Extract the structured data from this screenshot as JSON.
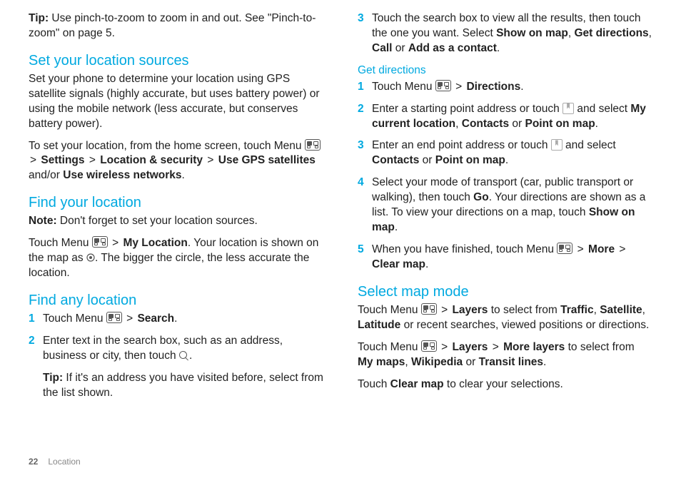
{
  "col1": {
    "tip_label": "Tip:",
    "tip_text": " Use pinch-to-zoom to zoom in and out. See \"Pinch-to-zoom\" on page 5.",
    "h_sources": "Set your location sources",
    "p_sources": "Set your phone to determine your location using GPS satellite signals (highly accurate, but uses battery power) or using the mobile network (less accurate, but conserves battery power).",
    "p_set1": "To set your location, from the home screen, touch Menu ",
    "gt": ">",
    "b_settings": "Settings",
    "b_locsec": "Location & security",
    "b_usegps": "Use GPS satellites",
    "p_set_andor": " and/or ",
    "b_usewifi": "Use wireless networks",
    "period": ".",
    "h_findyour": "Find your location",
    "note_label": "Note:",
    "note_text": " Don't forget to set your location sources.",
    "p_touchmenu": "Touch Menu ",
    "b_myloc": "My Location",
    "p_myloc2": ". Your location is shown on the map as ",
    "p_myloc3": ". The bigger the circle, the less accurate the location.",
    "h_findany": "Find any location",
    "s1_pre": "Touch Menu ",
    "b_search": "Search",
    "s2": "Enter text in the search box, such as an address, business or city, then touch ",
    "s2_tip_label": "Tip:",
    "s2_tip": " If it's an address you have visited before, select from the list shown."
  },
  "col2": {
    "s3a": "Touch the search box to view all the results, then touch the one you want. Select ",
    "b_showmap": "Show on map",
    "comma_sp": ", ",
    "b_getdir": "Get directions",
    "b_call": "Call",
    "or_sp": " or ",
    "b_addcontact": "Add as a contact",
    "period": ".",
    "h_getdir": "Get directions",
    "d1_pre": "Touch Menu ",
    "gt": ">",
    "b_directions": "Directions",
    "d2a": "Enter a starting point address or touch ",
    "d2b": " and select ",
    "b_mycurrent": "My current location",
    "b_contacts": "Contacts",
    "b_pointmap": "Point on map",
    "d3a": "Enter an end point address or touch ",
    "d3b": " and select ",
    "d4a": "Select your mode of transport (car, public transport or walking), then touch ",
    "b_go": "Go",
    "d4b": ". Your directions are shown as a list. To view your directions on a map, touch ",
    "d5a": "When you have finished, touch Menu ",
    "b_more": "More",
    "b_clearmap": "Clear map",
    "h_mapmode": "Select map mode",
    "m1a": "Touch Menu ",
    "b_layers": "Layers",
    "m1b": " to select from ",
    "b_traffic": "Traffic",
    "b_satellite": "Satellite",
    "b_latitude": "Latitude",
    "m1c": " or recent searches, viewed positions or directions.",
    "m2b": " to select from ",
    "b_morelayers": "More layers",
    "b_mymaps": "My maps",
    "b_wikipedia": "Wikipedia",
    "b_transit": "Transit lines",
    "m3a": "Touch ",
    "m3b": " to clear your selections."
  },
  "footer": {
    "page": "22",
    "section": "Location"
  }
}
